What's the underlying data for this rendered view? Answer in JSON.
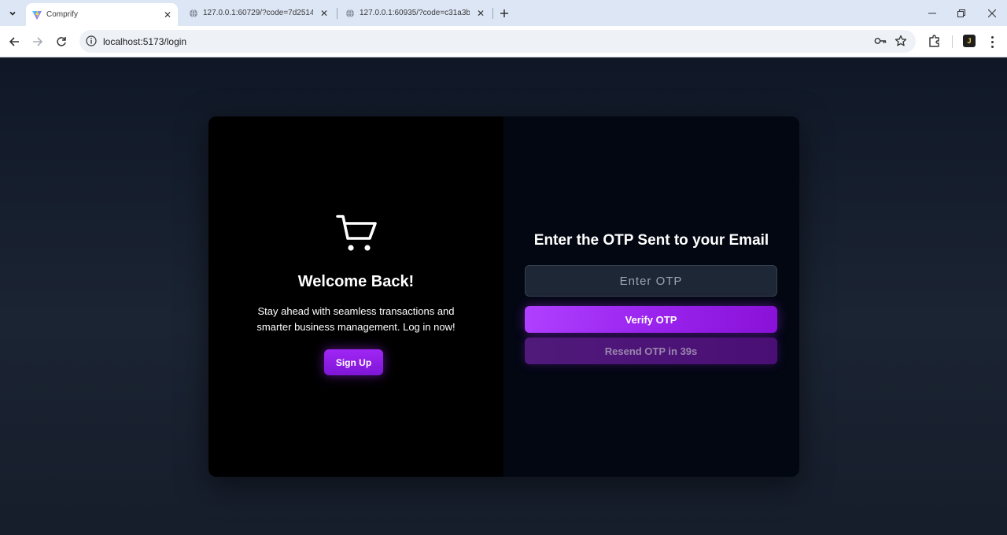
{
  "browser": {
    "tabs": [
      {
        "title": "Comprify",
        "active": true
      },
      {
        "title": "127.0.0.1:60729/?code=7d2514",
        "active": false
      },
      {
        "title": "127.0.0.1:60935/?code=c31a3b",
        "active": false
      }
    ],
    "url": "localhost:5173/login",
    "profile_initial": "J"
  },
  "left_panel": {
    "icon": "shopping-cart-icon",
    "title": "Welcome Back!",
    "description": "Stay ahead with seamless transactions and smarter business management. Log in now!",
    "signup_label": "Sign Up"
  },
  "right_panel": {
    "title": "Enter the OTP Sent to your Email",
    "otp_placeholder": "Enter OTP",
    "otp_value": "",
    "verify_label": "Verify OTP",
    "resend_label": "Resend OTP in 39s"
  },
  "colors": {
    "accent": "#a126f5",
    "left_bg": "#000000",
    "right_bg": "#030712",
    "page_bg": "#1b2230"
  }
}
